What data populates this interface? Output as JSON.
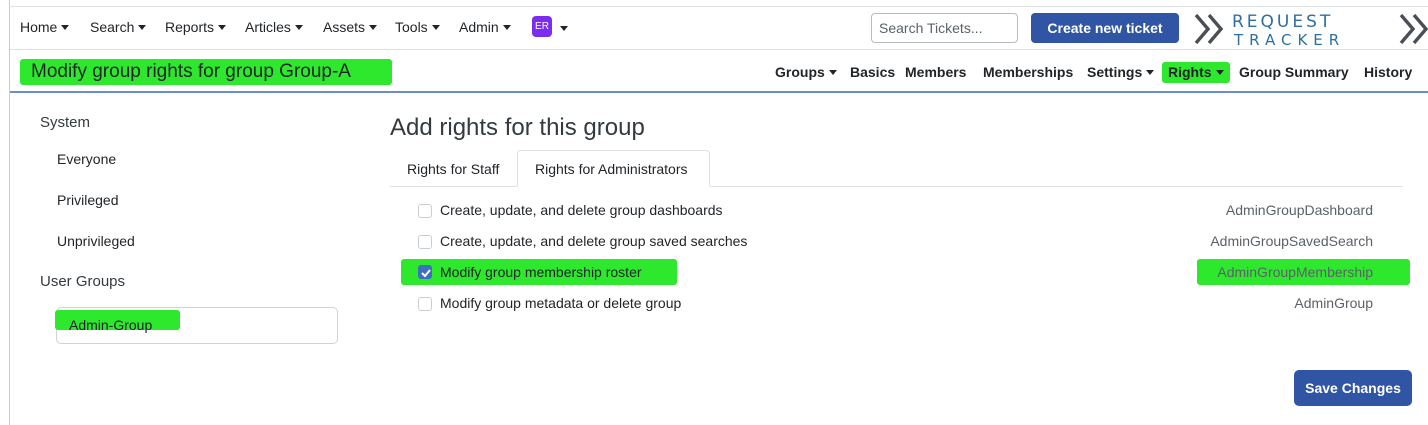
{
  "nav": {
    "items": [
      {
        "label": "Home"
      },
      {
        "label": "Search"
      },
      {
        "label": "Reports"
      },
      {
        "label": "Articles"
      },
      {
        "label": "Assets"
      },
      {
        "label": "Tools"
      },
      {
        "label": "Admin"
      }
    ],
    "avatar_initials": "ER",
    "search_placeholder": "Search Tickets...",
    "create_button": "Create new ticket",
    "logo": {
      "line1": "REQUEST",
      "line2": "TRACKER"
    }
  },
  "page": {
    "title": "Modify group rights for group Group-A",
    "subnav": [
      {
        "label": "Groups",
        "dropdown": true
      },
      {
        "label": "Basics",
        "dropdown": false
      },
      {
        "label": "Members",
        "dropdown": false
      },
      {
        "label": "Memberships",
        "dropdown": false
      },
      {
        "label": "Settings",
        "dropdown": true
      },
      {
        "label": "Rights",
        "dropdown": true,
        "active": true
      },
      {
        "label": "Group Summary",
        "dropdown": false
      },
      {
        "label": "History",
        "dropdown": false
      }
    ]
  },
  "left": {
    "system_heading": "System",
    "system_items": [
      "Everyone",
      "Privileged",
      "Unprivileged"
    ],
    "user_groups_heading": "User Groups",
    "user_groups": [
      "Admin-Group"
    ]
  },
  "main": {
    "heading": "Add rights for this group",
    "tabs": [
      {
        "label": "Rights for Staff",
        "active": false
      },
      {
        "label": "Rights for Administrators",
        "active": true
      }
    ],
    "rights": [
      {
        "label": "Create, update, and delete group dashboards",
        "code": "AdminGroupDashboard",
        "checked": false
      },
      {
        "label": "Create, update, and delete group saved searches",
        "code": "AdminGroupSavedSearch",
        "checked": false
      },
      {
        "label": "Modify group membership roster",
        "code": "AdminGroupMembership",
        "checked": true
      },
      {
        "label": "Modify group metadata or delete group",
        "code": "AdminGroup",
        "checked": false
      }
    ],
    "save_button": "Save Changes"
  },
  "colors": {
    "highlight": "#2ee82e",
    "primary_button": "#2f55a4",
    "avatar": "#7b2cf0",
    "logo": "#2f6fa0"
  }
}
